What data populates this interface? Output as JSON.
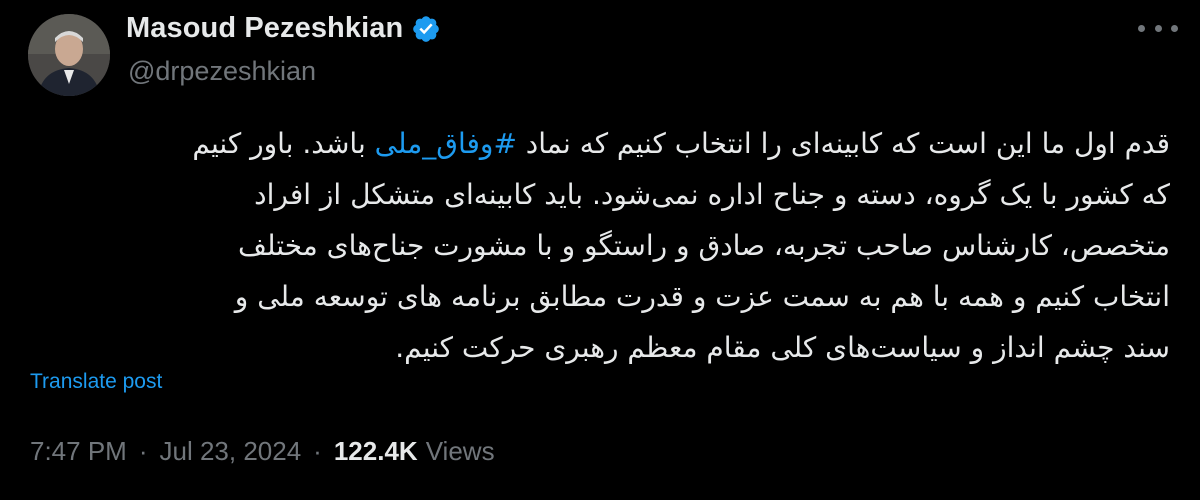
{
  "author": {
    "display_name": "Masoud Pezeshkian",
    "handle": "@drpezeshkian",
    "verified": true,
    "verified_badge_color": "#1d9bf0"
  },
  "tweet": {
    "lines": [
      {
        "before": "قدم اول ما این است که کابینه‌ای را انتخاب کنیم که نماد ",
        "hashtag": "#وفاق_ملی",
        "after": " باشد. باور کنیم"
      },
      {
        "text": "که کشور با یک گروه، دسته و جناح اداره نمی‌شود. باید کابینه‌ای متشکل از افراد"
      },
      {
        "text": "متخصص، کارشناس صاحب تجربه، صادق و راستگو و با مشورت جناح‌های مختلف"
      },
      {
        "text": "انتخاب کنیم و همه با هم به سمت عزت و قدرت مطابق برنامه های توسعه ملی و"
      },
      {
        "text": "سند چشم انداز و سیاست‌های کلی مقام معظم رهبری حرکت کنیم."
      }
    ],
    "translate_label": "Translate post",
    "time": "7:47 PM",
    "date": "Jul 23, 2024",
    "separator": "·",
    "views_count": "122.4K",
    "views_label": "Views"
  },
  "colors": {
    "background": "#000000",
    "text": "#e7e9ea",
    "secondary": "#71767b",
    "link": "#1d9bf0"
  },
  "icons": {
    "more": "more-icon",
    "verified": "verified-badge-icon"
  }
}
